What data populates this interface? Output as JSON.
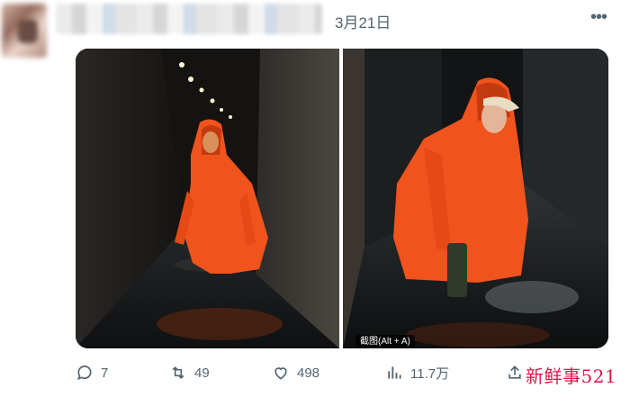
{
  "post": {
    "date": "3月21日",
    "more_icon": "more-horizontal-icon",
    "media": {
      "alt_badge": "截图(Alt + A)"
    }
  },
  "actions": {
    "replies": "7",
    "retweets": "49",
    "likes": "498",
    "views": "11.7万"
  },
  "watermark": "新鲜事521",
  "colors": {
    "secondary_text": "#536471",
    "raincoat_orange": "#f0531c",
    "watermark_red": "#e0134b"
  }
}
